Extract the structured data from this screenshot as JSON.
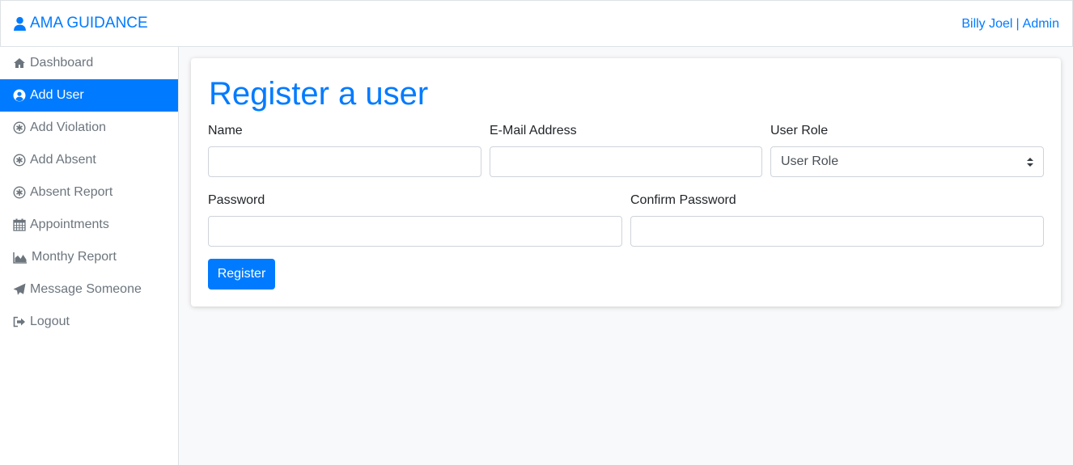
{
  "header": {
    "brand": "AMA GUIDANCE",
    "user_name": "Billy Joel",
    "separator": "|",
    "role": "Admin"
  },
  "sidebar": {
    "items": [
      {
        "label": "Dashboard",
        "icon": "home-icon",
        "active": false
      },
      {
        "label": "Add User",
        "icon": "user-circle-icon",
        "active": true
      },
      {
        "label": "Add Violation",
        "icon": "asterisk-circle-icon",
        "active": false
      },
      {
        "label": "Add Absent",
        "icon": "asterisk-circle-icon",
        "active": false
      },
      {
        "label": "Absent Report",
        "icon": "asterisk-circle-icon",
        "active": false
      },
      {
        "label": "Appointments",
        "icon": "calendar-icon",
        "active": false
      },
      {
        "label": "Monthy Report",
        "icon": "area-chart-icon",
        "active": false
      },
      {
        "label": "Message Someone",
        "icon": "paper-plane-icon",
        "active": false
      },
      {
        "label": "Logout",
        "icon": "sign-out-icon",
        "active": false
      }
    ]
  },
  "form": {
    "title": "Register a user",
    "name_label": "Name",
    "name_value": "",
    "email_label": "E-Mail Address",
    "email_value": "",
    "role_label": "User Role",
    "role_selected": "User Role",
    "password_label": "Password",
    "password_value": "",
    "confirm_label": "Confirm Password",
    "confirm_value": "",
    "submit_label": "Register"
  },
  "colors": {
    "accent": "#007bff",
    "muted": "#6c757d",
    "background": "#f8f9fa"
  }
}
